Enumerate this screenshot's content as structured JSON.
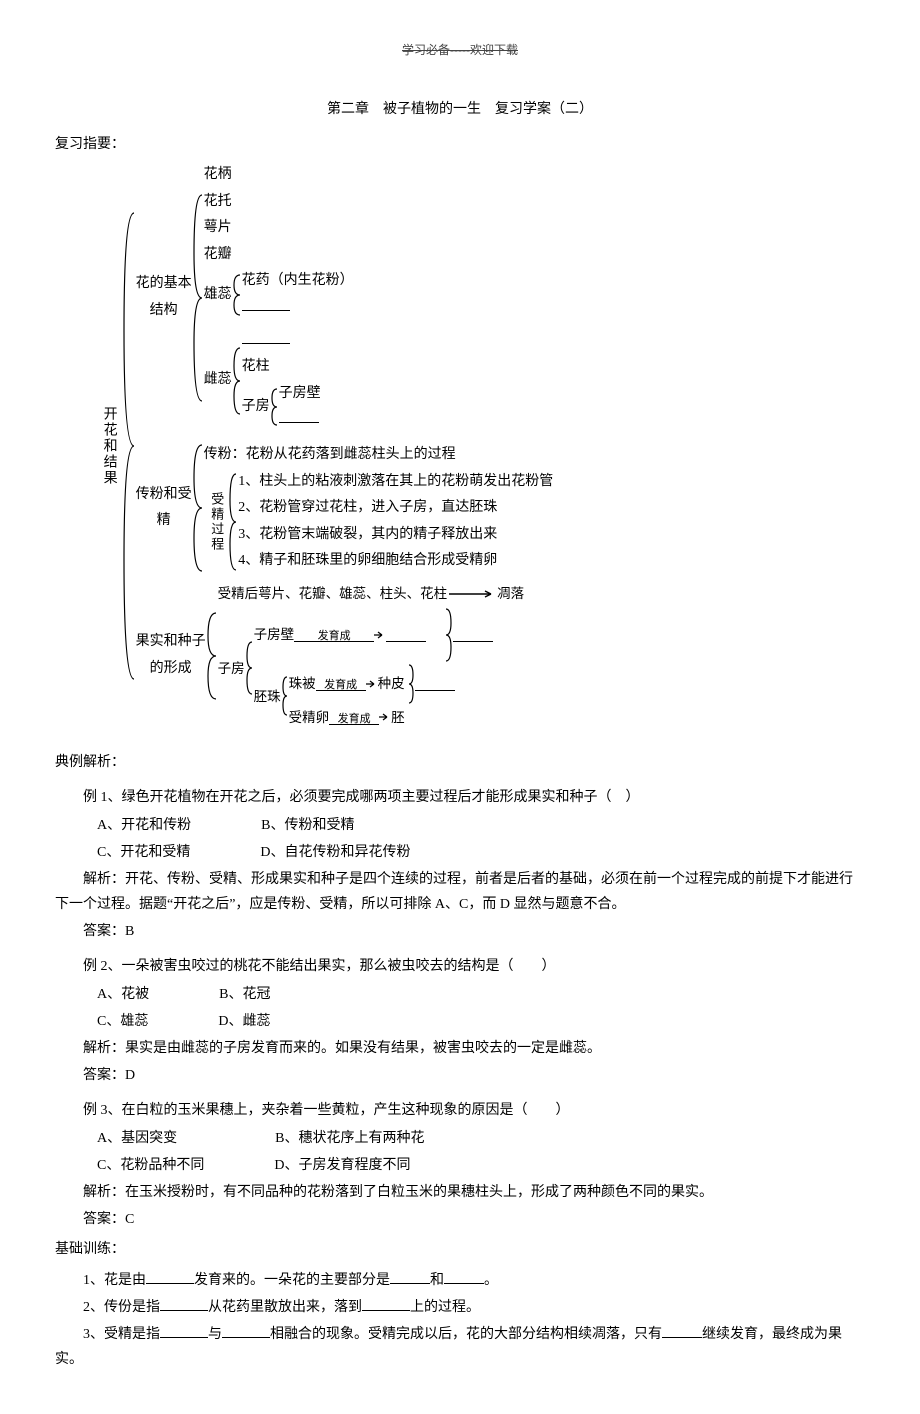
{
  "header_note": "学习必备-----欢迎下载",
  "chapter_title": "第二章　被子植物的一生　复习学案（二）",
  "section_review": "复习指要：",
  "diagram": {
    "root": "开花和结果",
    "branch1": {
      "label": "花的基本结构",
      "items": [
        "花柄",
        "花托",
        "萼片",
        "花瓣"
      ],
      "stamen": {
        "label": "雄蕊",
        "child": "花药（内生花粉）"
      },
      "pistil": {
        "label": "雌蕊",
        "mid": "花柱",
        "ovary": {
          "label": "子房",
          "child": "子房壁"
        }
      }
    },
    "branch2": {
      "label": "传粉和受精",
      "pollination": "传粉：花粉从花药落到雌蕊柱头上的过程",
      "proc_label": "受精过程",
      "steps": [
        "1、柱头上的粘液刺激落在其上的花粉萌发出花粉管",
        "2、花粉管穿过花柱，进入子房，直达胚珠",
        "3、花粉管末端破裂，其内的精子释放出来",
        "4、精子和胚珠里的卵细胞结合形成受精卵"
      ]
    },
    "branch3": {
      "label": "果实和种子的形成",
      "line1_pre": "受精后萼片、花瓣、雄蕊、柱头、花柱",
      "line1_post": "凋落",
      "ovary_label": "子房",
      "wall": "子房壁",
      "ovule": "胚珠",
      "coat": "珠被",
      "zygote": "受精卵",
      "dev": "发育成",
      "seedcoat": "种皮",
      "embryo": "胚"
    }
  },
  "section_examples": "典例解析：",
  "ex1": {
    "q": "例 1、绿色开花植物在开花之后，必须要完成哪两项主要过程后才能形成果实和种子（　）",
    "a": "A、开花和传粉",
    "b": "B、传粉和受精",
    "c": "C、开花和受精",
    "d": "D、自花传粉和异花传粉",
    "analysis": "解析：开花、传粉、受精、形成果实和种子是四个连续的过程，前者是后者的基础，必须在前一个过程完成的前提下才能进行下一个过程。据题“开花之后”，应是传粉、受精，所以可排除 A、C，而 D 显然与题意不合。",
    "ans": "答案：B"
  },
  "ex2": {
    "q": "例 2、一朵被害虫咬过的桃花不能结出果实，那么被虫咬去的结构是（　　）",
    "a": "A、花被",
    "b": "B、花冠",
    "c": "C、雄蕊",
    "d": "D、雌蕊",
    "analysis": "解析：果实是由雌蕊的子房发育而来的。如果没有结果，被害虫咬去的一定是雌蕊。",
    "ans": "答案：D"
  },
  "ex3": {
    "q": "例 3、在白粒的玉米果穗上，夹杂着一些黄粒，产生这种现象的原因是（　　）",
    "a": "A、基因突变",
    "b": "B、穗状花序上有两种花",
    "c": "C、花粉品种不同",
    "d": "D、子房发育程度不同",
    "analysis": "解析：在玉米授粉时，有不同品种的花粉落到了白粒玉米的果穗柱头上，形成了两种颜色不同的果实。",
    "ans": "答案：C"
  },
  "section_training": "基础训练：",
  "t1_a": "1、花是由",
  "t1_b": "发育来的。一朵花的主要部分是",
  "t1_c": "和",
  "t1_d": "。",
  "t2_a": "2、传份是指",
  "t2_b": "从花药里散放出来，落到",
  "t2_c": "上的过程。",
  "t3_a": "3、受精是指",
  "t3_b": "与",
  "t3_c": "相融合的现象。受精完成以后，花的大部分结构相续凋落，只有",
  "t3_d": "继续发育，最终成为果实。"
}
